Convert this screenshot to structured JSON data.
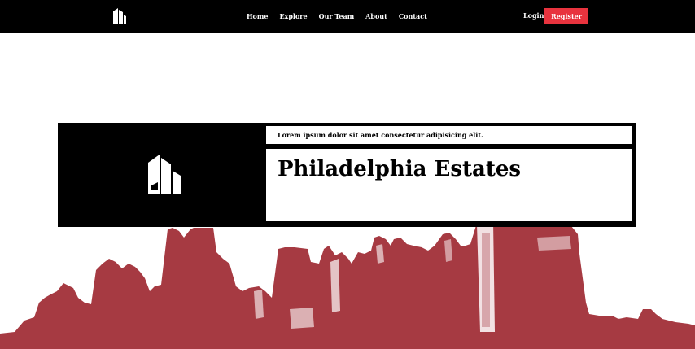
{
  "nav": {
    "logo_icon": "building-icon",
    "links": [
      "Home",
      "Explore",
      "Our Team",
      "About",
      "Contact"
    ],
    "active_link": "Home",
    "login_label": "Login",
    "register_label": "Register"
  },
  "hero": {
    "tagline": "Lorem ipsum dolor sit amet consectetur adipisicing elit.",
    "title": "Philadelphia Estates",
    "logo_icon": "building-icon"
  },
  "colors": {
    "navbar_bg": "#000000",
    "accent": "#e8333e",
    "skyline": "#a63a42",
    "card_bg": "#000000"
  }
}
